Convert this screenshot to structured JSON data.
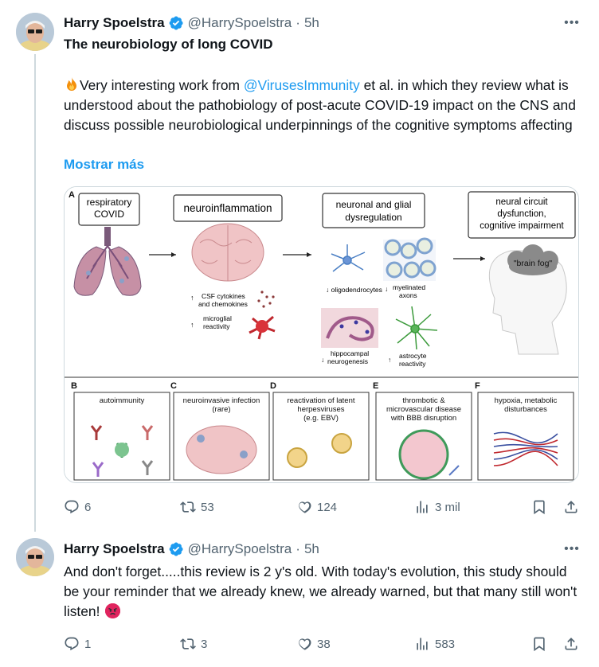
{
  "tweets": [
    {
      "author_name": "Harry Spoelstra",
      "author_handle": "@HarrySpoelstra",
      "dot": "·",
      "time": "5h",
      "title": "The neurobiology of long COVID",
      "body_prefix": "Very interesting work from ",
      "mention": "@VirusesImmunity",
      "body_suffix": "  et al. in which they review what is understood about the pathobiology of post-acute COVID-19 impact on the CNS and discuss possible neurobiological underpinnings of the cognitive symptoms affecting",
      "show_more": "Mostrar más",
      "actions": {
        "replies": "6",
        "reposts": "53",
        "likes": "124",
        "views": "3 mil"
      },
      "leading_emoji": "fire-icon"
    },
    {
      "author_name": "Harry Spoelstra",
      "author_handle": "@HarrySpoelstra",
      "dot": "·",
      "time": "5h",
      "body": "And don't forget.....this review is 2 y's old. With today's evolution, this study should be your reminder that  we already knew, we already warned, but that many still won't listen!",
      "trailing_emoji": "angry-face-icon",
      "actions": {
        "replies": "1",
        "reposts": "3",
        "likes": "38",
        "views": "583"
      }
    }
  ],
  "figure": {
    "panel_a": {
      "letter": "A",
      "respiratory": [
        "respiratory",
        "COVID"
      ],
      "neuroinflammation": "neuroinflammation",
      "csf": [
        "CSF cytokines",
        "and chemokines"
      ],
      "microglial": [
        "microglial",
        "reactivity"
      ],
      "dysregulation": [
        "neuronal and glial",
        "dysregulation"
      ],
      "oligodendrocytes": "oligodendrocytes",
      "myelinated": [
        "myelinated",
        "axons"
      ],
      "hippocampal": [
        "hippocampal",
        "neurogenesis"
      ],
      "astrocyte": [
        "astrocyte",
        "reactivity"
      ],
      "circuit": [
        "neural circuit",
        "dysfunction,",
        "cognitive impairment"
      ],
      "brain_fog": "\"brain fog\""
    },
    "panels": [
      {
        "letter": "B",
        "label": [
          "autoimmunity"
        ]
      },
      {
        "letter": "C",
        "label": [
          "neuroinvasive infection",
          "(rare)"
        ]
      },
      {
        "letter": "D",
        "label": [
          "reactivation of latent",
          "herpesviruses",
          "(e.g. EBV)"
        ]
      },
      {
        "letter": "E",
        "label": [
          "thrombotic &",
          "microvascular disease",
          "with BBB disruption"
        ]
      },
      {
        "letter": "F",
        "label": [
          "hypoxia, metabolic",
          "disturbances"
        ]
      }
    ]
  },
  "colors": {
    "accent": "#1d9bf0",
    "secondary_text": "#536471",
    "verified": "#1d9bf0",
    "angry_emoji": "#e0245e"
  }
}
